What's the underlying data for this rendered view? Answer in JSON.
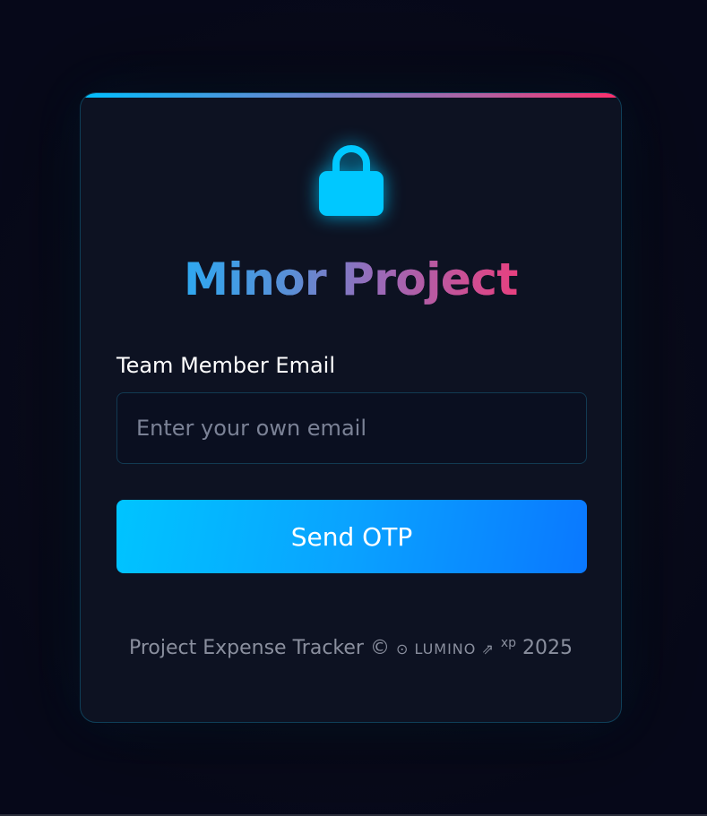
{
  "card": {
    "title": "Minor Project",
    "lock_icon": "lock-icon",
    "accent_gradient": [
      "#00bfff",
      "#ff2e6b"
    ]
  },
  "form": {
    "email_label": "Team Member Email",
    "email_placeholder": "Enter your own email",
    "email_value": "",
    "submit_label": "Send OTP"
  },
  "footer": {
    "prefix": "Project Expense Tracker ©",
    "brand": "⊙ LUMINO ⇗",
    "sup": "xp",
    "year": "2025"
  },
  "colors": {
    "button_start": "#00c4ff",
    "button_end": "#0a78ff",
    "lock": "#00c8ff",
    "background": "#080a18"
  }
}
